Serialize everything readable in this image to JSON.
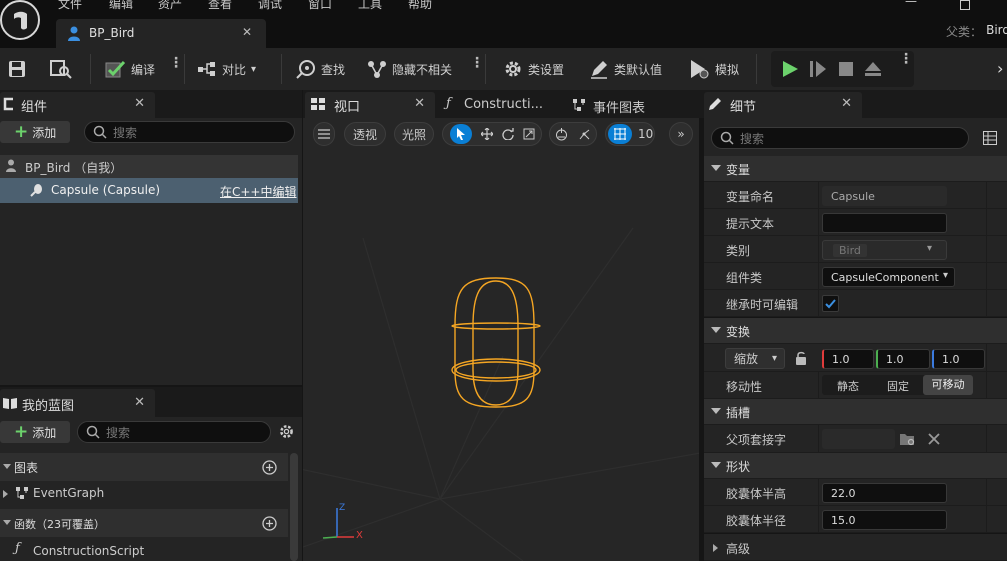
{
  "menu": [
    "文件",
    "编辑",
    "资产",
    "查看",
    "调试",
    "窗口",
    "工具",
    "帮助"
  ],
  "doc_tab": {
    "title": "BP_Bird"
  },
  "parent": {
    "label": "父类：",
    "value": "Bird"
  },
  "toolbar": {
    "compile": "编译",
    "diff": "对比",
    "find": "查找",
    "hide_unrelated": "隐藏不相关",
    "class_settings": "类设置",
    "class_defaults": "类默认值",
    "simulate": "模拟"
  },
  "components": {
    "tab": "组件",
    "add": "添加",
    "search_placeholder": "搜索",
    "root": "BP_Bird （自我）",
    "item": "Capsule (Capsule)",
    "edit_cpp": "在C++中编辑"
  },
  "my_blueprint": {
    "tab": "我的蓝图",
    "add": "添加",
    "search_placeholder": "搜索",
    "sections": {
      "graphs": "图表",
      "functions": "函数（23可覆盖）"
    },
    "event_graph": "EventGraph",
    "construction_script": "ConstructionScript"
  },
  "editor_tabs": {
    "viewport": "视口",
    "construction": "Constructi...",
    "event_graph": "事件图表"
  },
  "viewport": {
    "perspective": "透视",
    "lit": "光照",
    "grid_snap": "10",
    "axis": {
      "x": "X",
      "z": "Z"
    }
  },
  "details": {
    "tab": "细节",
    "search_placeholder": "搜索",
    "cat_variable": "变量",
    "var_name_label": "变量命名",
    "var_name": "Capsule",
    "tooltip_label": "提示文本",
    "tooltip": "",
    "category_label": "类别",
    "category": "Bird",
    "component_class_label": "组件类",
    "component_class": "CapsuleComponent",
    "editable_label": "继承时可编辑",
    "editable": true,
    "cat_transform": "变换",
    "scale_label": "缩放",
    "scale": {
      "x": "1.0",
      "y": "1.0",
      "z": "1.0"
    },
    "mobility_label": "移动性",
    "mobility": {
      "static": "静态",
      "stationary": "固定",
      "movable": "可移动"
    },
    "cat_sockets": "插槽",
    "parent_socket_label": "父项套接字",
    "parent_socket": "",
    "cat_shape": "形状",
    "half_height_label": "胶囊体半高",
    "half_height": "22.0",
    "radius_label": "胶囊体半径",
    "radius": "15.0",
    "cat_advanced": "高级"
  },
  "colors": {
    "accent": "#0a7fd5",
    "green": "#6cd26c",
    "capsule": "#f5a623",
    "x_axis": "#e03b3b",
    "y_axis": "#4caf50",
    "z_axis": "#3b7be0"
  }
}
